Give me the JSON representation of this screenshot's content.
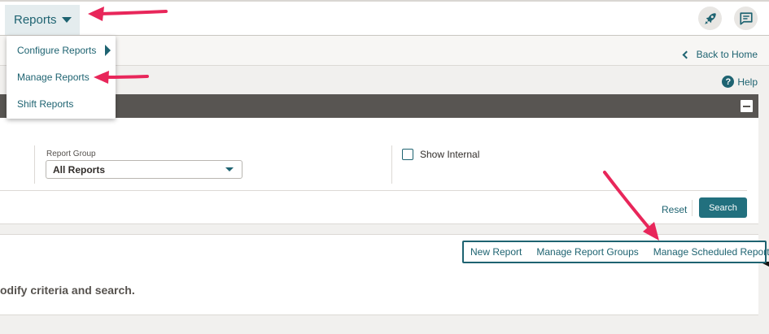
{
  "nav": {
    "reports_label": "Reports"
  },
  "icons": {
    "rocket": "rocket-icon",
    "chat": "chat-icon"
  },
  "menu": {
    "items": [
      {
        "label": "Configure Reports",
        "has_submenu": true
      },
      {
        "label": "Manage Reports"
      },
      {
        "label": "Shift Reports"
      }
    ]
  },
  "header": {
    "back_to_home": "Back to Home",
    "help": "Help"
  },
  "criteria": {
    "report_group_label": "Report Group",
    "report_group_value": "All Reports",
    "show_internal_label": "Show Internal",
    "show_internal_checked": false,
    "reset_label": "Reset",
    "search_label": "Search"
  },
  "results": {
    "links": [
      "New Report",
      "Manage Report Groups",
      "Manage Scheduled Reports"
    ],
    "empty_message": "odify criteria and search."
  },
  "colors": {
    "accent": "#1e6371",
    "annotation_arrow": "#e8265a",
    "dark_bar": "#585552"
  }
}
